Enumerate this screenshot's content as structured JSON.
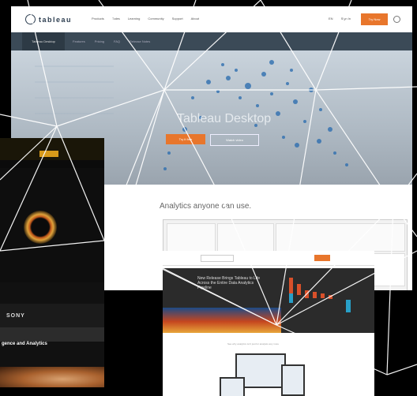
{
  "main": {
    "logo": "tableau",
    "nav": [
      "Products",
      "Sales",
      "Learning",
      "Community",
      "Support",
      "About"
    ],
    "right_nav": [
      "EN",
      "Sign In"
    ],
    "trial_button": "Try Now",
    "subnav_active": "Tableau Desktop",
    "subnav": [
      "Features",
      "Pricing",
      "FAQ",
      "Release Notes"
    ],
    "hero_title": "Tableau Desktop",
    "hero_button": "Try it free",
    "hero_button2": "Watch video",
    "tagline": "Analytics anyone can use."
  },
  "left": {
    "brand": "SONY",
    "heading": "gence and Analytics"
  },
  "bottom": {
    "hero_text": "New Release Brings Tableau to Life Across the Entire Data Analytics Pipeline",
    "caption": "See why analytics isn't just for analysts any more"
  },
  "colors": {
    "accent": "#e8762c",
    "dark_nav": "#3b4a57",
    "background": "#000000"
  }
}
